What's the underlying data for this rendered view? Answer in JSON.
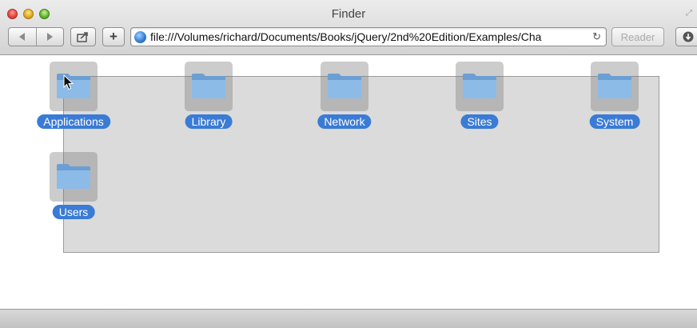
{
  "window": {
    "title": "Finder"
  },
  "toolbar": {
    "back_icon": "back-arrow",
    "forward_icon": "forward-arrow",
    "share_icon": "share",
    "add_label": "+",
    "url": "file:///Volumes/richard/Documents/Books/jQuery/2nd%20Edition/Examples/Cha",
    "reload_icon": "reload",
    "reader_label": "Reader",
    "downloads_icon": "download"
  },
  "folders": [
    {
      "label": "Applications",
      "icon": "folder"
    },
    {
      "label": "Library",
      "icon": "folder"
    },
    {
      "label": "Network",
      "icon": "folder"
    },
    {
      "label": "Sites",
      "icon": "folder"
    },
    {
      "label": "System",
      "icon": "folder"
    },
    {
      "label": "Users",
      "icon": "folder"
    }
  ],
  "colors": {
    "selection_label": "#3a7bd5",
    "folder_blue": "#7fb0e0"
  }
}
